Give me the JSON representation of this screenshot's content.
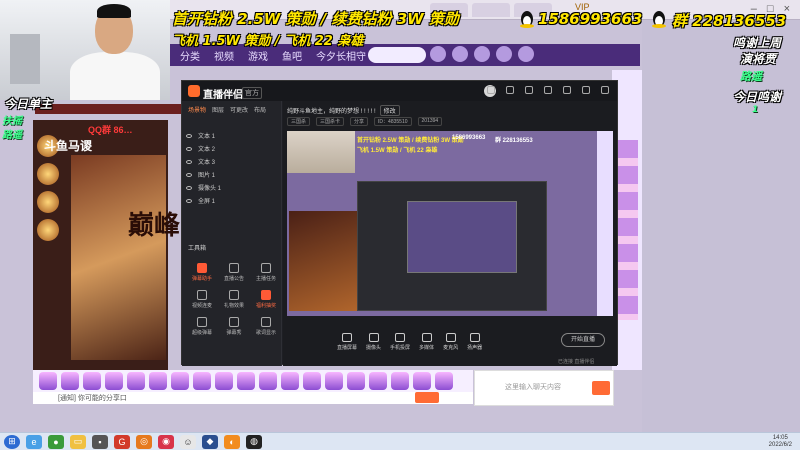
{
  "overlay": {
    "line1": "首开钻粉 2.5W 策勋 / 续费钻粉 3W 策勋",
    "line2": "飞机 1.5W 策勋 / 飞机 22 枭雄",
    "qq_number": "1586993663",
    "group_label": "群 228136553",
    "thanks_top": "鸣谢上周",
    "thanks_name": "演将贾",
    "thanks_today": "今日鸣谢",
    "green_mid": "路遥",
    "green_small": "1",
    "today_host": "今日单主",
    "left_green_1": "扶摇",
    "left_green_2": "路遥"
  },
  "browser": {
    "vip_label": "VIP"
  },
  "site": {
    "nav_items": [
      "分类",
      "视频",
      "游戏",
      "鱼吧",
      "今夕长相守"
    ],
    "left_stream_title": "斗鱼马谡",
    "red_text": "QQ群 86…",
    "big_glyph": "巅峰"
  },
  "app": {
    "title": "直播伴侣",
    "version": "官方",
    "scene_tabs": [
      "场景物",
      "图层",
      "可更改",
      "布局"
    ],
    "layers": [
      "文本 1",
      "文本 2",
      "文本 3",
      "图片 1",
      "摄像头 1",
      "全屏 1"
    ],
    "tool_label": "工具箱",
    "tools": [
      {
        "label": "弹幕助手",
        "hot": true
      },
      {
        "label": "直播公告",
        "hot": false
      },
      {
        "label": "主播任务",
        "hot": false
      },
      {
        "label": "视频连麦",
        "hot": false
      },
      {
        "label": "礼物效果",
        "hot": false
      },
      {
        "label": "福利抽奖",
        "hot": true
      },
      {
        "label": "超级弹幕",
        "hot": false
      },
      {
        "label": "弹幕秀",
        "hot": false
      },
      {
        "label": "歌词显示",
        "hot": false
      }
    ],
    "left_footer": "一小热门直播游戏推荐",
    "toolbar": {
      "text": "纯野斗鱼地主，纯野的梦想 ! ! ! ! !",
      "btn": "修改"
    },
    "sub_tags": [
      "三国杀",
      "三国杀卡",
      "分享",
      "ID：4835510",
      "201394"
    ],
    "bottom_items": [
      "直播屏幕",
      "摄像头",
      "手机投屏",
      "多媒体",
      "麦克风",
      "扬声器"
    ],
    "start_label": "开始直播",
    "status": "已连接  直播伴侣"
  },
  "preview": {
    "line1": "首开钻粉 2.5W 策勋 / 续费钻粉 3W 策勋",
    "line2": "飞机 1.5W 策勋 / 飞机 22 枭雄",
    "qq": "1586993663",
    "group": "群 228136553"
  },
  "bottom": {
    "notice": "[通知] 你可能的分享口",
    "chat_placeholder": "这里输入聊天内容"
  },
  "taskbar": {
    "time": "14:05",
    "date": "2022/6/2"
  }
}
